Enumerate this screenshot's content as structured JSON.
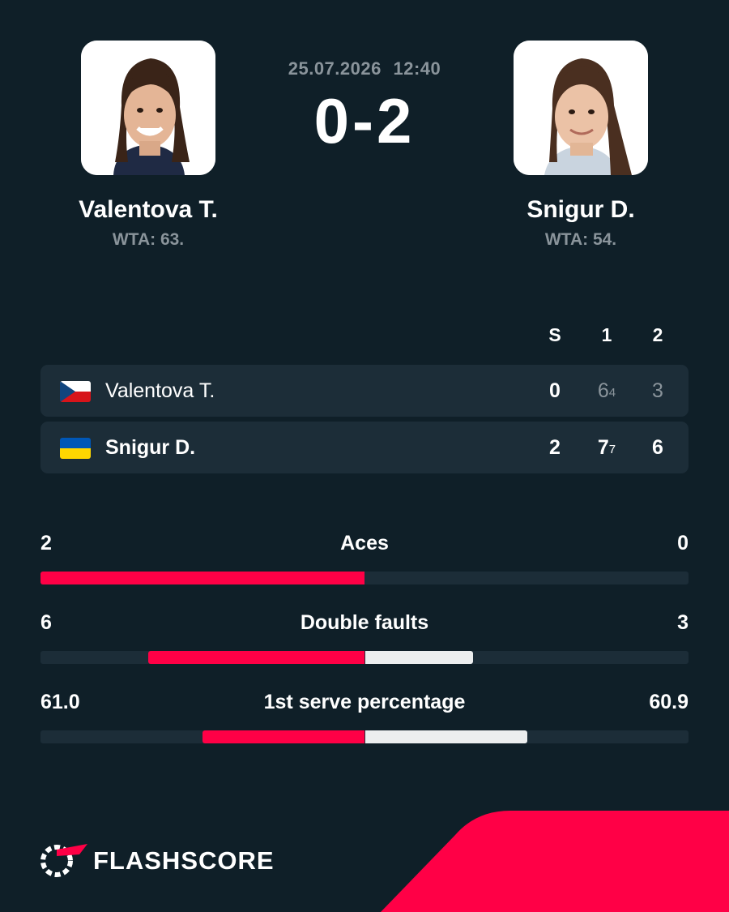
{
  "match": {
    "date": "25.07.2026",
    "time": "12:40",
    "score": "0-2"
  },
  "players": [
    {
      "name": "Valentova T.",
      "rank": "WTA: 63.",
      "country_flag": "czech-republic"
    },
    {
      "name": "Snigur D.",
      "rank": "WTA: 54.",
      "country_flag": "ukraine"
    }
  ],
  "scoreboard": {
    "headers": [
      "S",
      "1",
      "2"
    ],
    "rows": [
      {
        "name": "Valentova T.",
        "sets": "0",
        "set1": "6",
        "set1_tiebreak": "4",
        "set2": "3"
      },
      {
        "name": "Snigur D.",
        "sets": "2",
        "set1": "7",
        "set1_tiebreak": "7",
        "set2": "6"
      }
    ]
  },
  "stats": [
    {
      "label": "Aces",
      "left": "2",
      "right": "0",
      "left_share": 1.0,
      "right_share": 0.0
    },
    {
      "label": "Double faults",
      "left": "6",
      "right": "3",
      "left_share": 0.667,
      "right_share": 0.333
    },
    {
      "label": "1st serve percentage",
      "left": "61.0",
      "right": "60.9",
      "left_share": 0.5,
      "right_share": 0.5
    }
  ],
  "brand": {
    "name": "FLASHSCORE",
    "accent_color": "#ff0046",
    "background_color": "#0f1f28",
    "icon": "flashscore-logo-icon"
  }
}
